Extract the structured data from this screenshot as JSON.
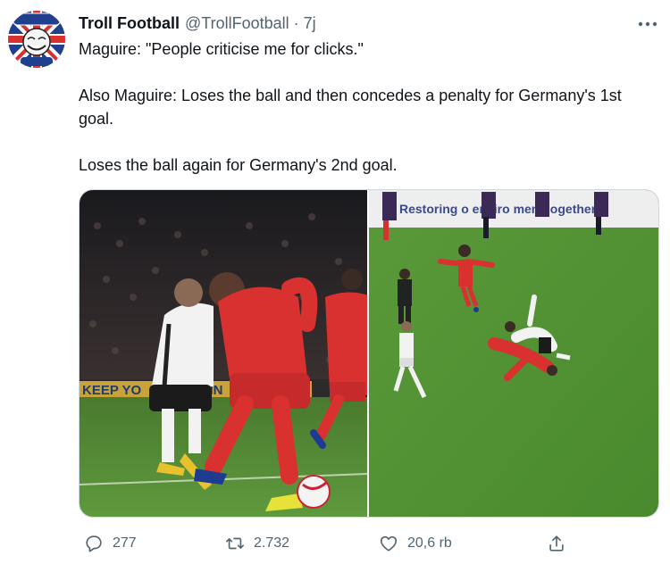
{
  "tweet": {
    "author_name": "Troll Football",
    "author_handle": "@TrollFootball",
    "separator": "·",
    "time": "7j",
    "avatar_text": "SOCCER",
    "avatar_subtext": "DON'T YOU MEAN FOOTBALL?",
    "text_lines": [
      "Maguire: \"People criticise me for clicks.\"",
      "Also Maguire: Loses the ball and then concedes a penalty for Germany's 1st goal.",
      "Loses the ball again for Germany's 2nd goal."
    ],
    "media": {
      "left_image": {
        "board_text": "KEEP YO",
        "board_text_2": "ANN"
      },
      "right_image": {
        "banner_text": "Restoring o  enviro ment, ogether."
      }
    },
    "actions": {
      "reply_count": "277",
      "retweet_count": "2.732",
      "like_count": "20,6 rb",
      "share_label": ""
    }
  },
  "colors": {
    "text_primary": "#0f1419",
    "text_secondary": "#536471",
    "border": "#cfd9de",
    "england_red": "#d9312f",
    "germany_white": "#f2f2f2",
    "pitch_green": "#5f9a3e"
  },
  "icons": [
    "more-icon",
    "reply-icon",
    "retweet-icon",
    "like-icon",
    "share-icon"
  ]
}
